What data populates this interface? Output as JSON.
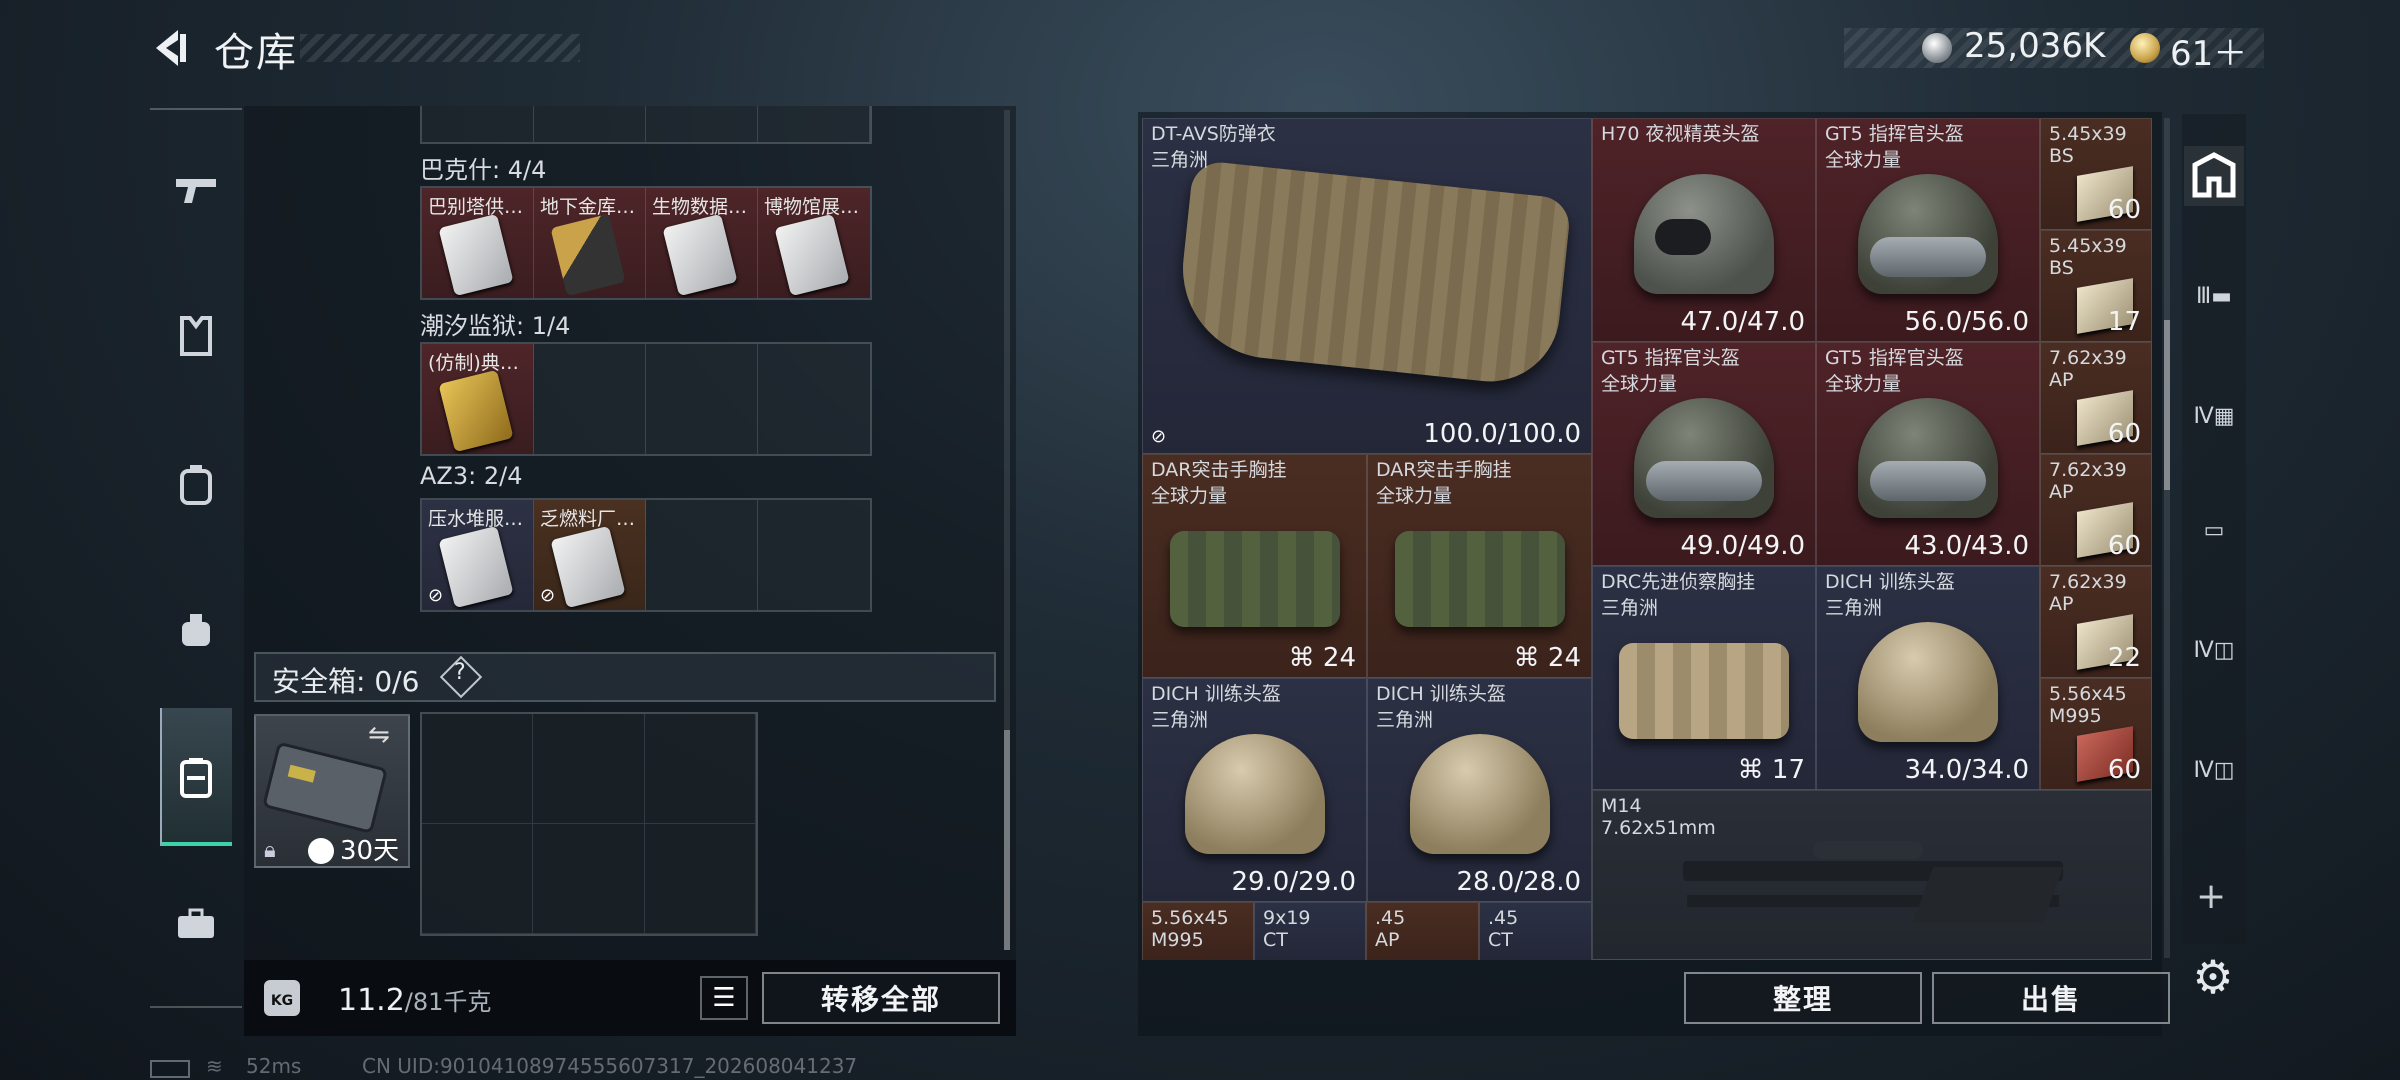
{
  "header": {
    "title": "仓库",
    "currency_silver": "25,036K",
    "currency_gold": "61＋"
  },
  "left_nav": [
    "pistol-icon",
    "armor-icon",
    "backpack-icon",
    "rig-icon",
    "container-icon",
    "toolbox-icon"
  ],
  "left_panel": {
    "groups": [
      {
        "label": "巴克什: 4/4",
        "items": [
          {
            "name": "巴别塔供…",
            "rarity": "red",
            "card": "white"
          },
          {
            "name": "地下金库…",
            "rarity": "red",
            "card": "gold-dark"
          },
          {
            "name": "生物数据…",
            "rarity": "red",
            "card": "white"
          },
          {
            "name": "博物馆展…",
            "rarity": "red",
            "card": "white"
          }
        ]
      },
      {
        "label": "潮汐监狱: 1/4",
        "items": [
          {
            "name": "(仿制)典…",
            "rarity": "red",
            "card": "gold"
          }
        ]
      },
      {
        "label": "AZ3: 2/4",
        "items": [
          {
            "name": "压水堆服…",
            "rarity": "blue",
            "card": "white"
          },
          {
            "name": "乏燃料厂…",
            "rarity": "gold",
            "card": "white"
          }
        ]
      }
    ],
    "safebox": {
      "label": "安全箱: 0/6",
      "help": "?",
      "timer": "30天"
    },
    "weight_current": "11.2",
    "weight_max": "/81千克",
    "transfer_all": "转移全部"
  },
  "right_panel": {
    "items": [
      {
        "name": "DT-AVS防弹衣",
        "sub": "三角洲",
        "value": "100.0/100.0",
        "rarity": "blue"
      },
      {
        "name": "H70 夜视精英头盔",
        "sub": "",
        "value": "47.0/47.0",
        "rarity": "red"
      },
      {
        "name": "GT5 指挥官头盔",
        "sub": "全球力量",
        "value": "56.0/56.0",
        "rarity": "red"
      },
      {
        "name": "5.45x39",
        "sub": "BS",
        "value": "60",
        "rarity": "gold"
      },
      {
        "name": "5.45x39",
        "sub": "BS",
        "value": "17",
        "rarity": "gold"
      },
      {
        "name": "GT5 指挥官头盔",
        "sub": "全球力量",
        "value": "49.0/49.0",
        "rarity": "red"
      },
      {
        "name": "GT5 指挥官头盔",
        "sub": "全球力量",
        "value": "43.0/43.0",
        "rarity": "red"
      },
      {
        "name": "7.62x39",
        "sub": "AP",
        "value": "60",
        "rarity": "gold"
      },
      {
        "name": "7.62x39",
        "sub": "AP",
        "value": "60",
        "rarity": "gold"
      },
      {
        "name": "DAR突击手胸挂",
        "sub": "全球力量",
        "value": "24",
        "rarity": "gold"
      },
      {
        "name": "DAR突击手胸挂",
        "sub": "全球力量",
        "value": "24",
        "rarity": "gold"
      },
      {
        "name": "DRC先进侦察胸挂",
        "sub": "三角洲",
        "value": "17",
        "rarity": "blue"
      },
      {
        "name": "DICH 训练头盔",
        "sub": "三角洲",
        "value": "34.0/34.0",
        "rarity": "blue"
      },
      {
        "name": "7.62x39",
        "sub": "AP",
        "value": "22",
        "rarity": "gold"
      },
      {
        "name": "5.56x45",
        "sub": "M995",
        "value": "60",
        "rarity": "gold"
      },
      {
        "name": "DICH 训练头盔",
        "sub": "三角洲",
        "value": "29.0/29.0",
        "rarity": "blue"
      },
      {
        "name": "DICH 训练头盔",
        "sub": "三角洲",
        "value": "28.0/28.0",
        "rarity": "blue"
      },
      {
        "name": "M14",
        "sub": "7.62x51mm",
        "value": "",
        "rarity": "grey"
      },
      {
        "name": "5.56x45",
        "sub": "M995",
        "value": "",
        "rarity": "gold"
      },
      {
        "name": "9x19",
        "sub": "CT",
        "value": "",
        "rarity": "blue"
      },
      {
        "name": ".45",
        "sub": "AP",
        "value": "",
        "rarity": "gold"
      },
      {
        "name": ".45",
        "sub": "CT",
        "value": "",
        "rarity": "blue"
      }
    ],
    "sort": "整理",
    "sell": "出售"
  },
  "right_tabs": [
    "backpack-tab-icon",
    "tier3-rig-icon",
    "tier4-container-icon",
    "folder-icon",
    "tier4-case-icon",
    "tier4-case-icon-2"
  ],
  "status": {
    "ping": "52ms",
    "uid": "CN UID:9010410897455560731​7_202608041237"
  }
}
